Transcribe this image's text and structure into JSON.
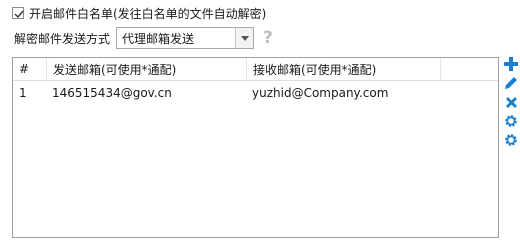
{
  "whitelist": {
    "checked": true,
    "label": "开启邮件白名单(发往白名单的文件自动解密)"
  },
  "method": {
    "label": "解密邮件发送方式",
    "selected": "代理邮箱发送",
    "help": "?"
  },
  "table": {
    "headers": [
      "#",
      "发送邮箱(可使用*通配)",
      "接收邮箱(可使用*通配)"
    ],
    "rows": [
      [
        "1",
        "146515434@gov.cn",
        "yuzhid@Company.com"
      ]
    ]
  },
  "tools": [
    "add-icon",
    "edit-icon",
    "delete-icon",
    "gear-icon",
    "gear-icon"
  ],
  "colors": {
    "accent": "#1a7fd1"
  }
}
